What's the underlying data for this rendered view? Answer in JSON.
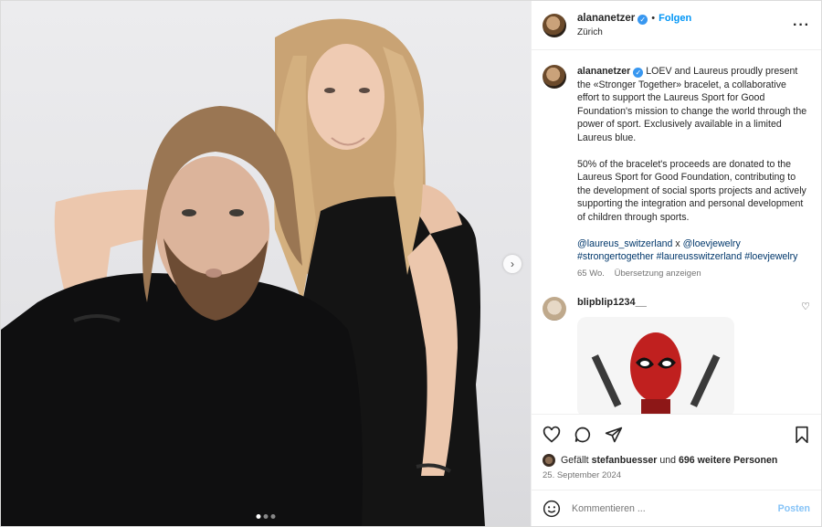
{
  "post": {
    "username": "alananetzer",
    "follow_label": "Folgen",
    "separator": "•",
    "location": "Zürich",
    "more_icon": "more-horizontal-icon",
    "verified_icon": "verified-badge-icon"
  },
  "caption": {
    "username": "alananetzer",
    "paragraph1": "LOEV and Laureus proudly present the «Stronger Together» bracelet, a collaborative effort to support the Laureus Sport for Good Foundation's mission to change the world through the power of sport. Exclusively available in a limited Laureus blue.",
    "paragraph2": "50% of the bracelet's proceeds are donated to the Laureus Sport for Good Foundation, contributing to the development of social sports projects and actively supporting the integration and personal development of children through sports.",
    "mention1": "@laureus_switzerland",
    "mention_sep": "x",
    "mention2": "@loevjewelry",
    "hashtag1": "#strongertogether",
    "hashtag2": "#laureusswitzerland",
    "hashtag3": "#loevjewelry",
    "age": "65 Wo.",
    "translate_label": "Übersetzung anzeigen"
  },
  "comment": {
    "username": "blipblip1234__"
  },
  "likes": {
    "prefix": "Gefällt",
    "user": "stefanbuesser",
    "middle": "und",
    "others": "696 weitere Personen"
  },
  "date": "25. September 2024",
  "add_comment": {
    "placeholder": "Kommentieren ...",
    "post_label": "Posten"
  },
  "carousel": {
    "total": 3,
    "active": 1
  },
  "colors": {
    "accent": "#0095f6",
    "link": "#00376b",
    "post_disabled": "#85c3f7"
  }
}
